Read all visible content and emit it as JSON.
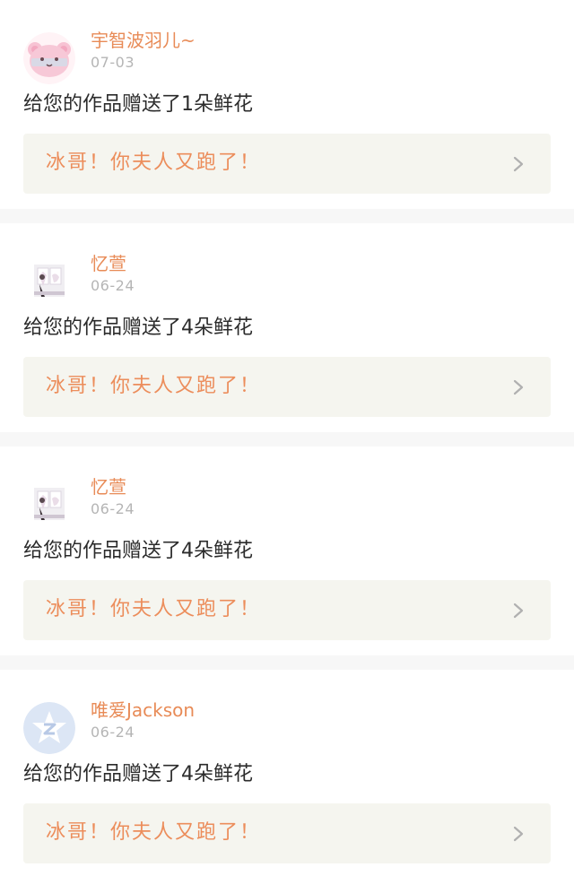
{
  "feed": {
    "items": [
      {
        "username": "宇智波羽儿~",
        "date": "07-03",
        "gift_text": "给您的作品赠送了1朵鲜花",
        "work_title": "冰哥！你夫人又跑了！",
        "avatar_icon": "pink-bear-avatar-icon"
      },
      {
        "username": "忆萱",
        "date": "06-24",
        "gift_text": "给您的作品赠送了4朵鲜花",
        "work_title": "冰哥！你夫人又跑了！",
        "avatar_icon": "photo-avatar-icon"
      },
      {
        "username": "忆萱",
        "date": "06-24",
        "gift_text": "给您的作品赠送了4朵鲜花",
        "work_title": "冰哥！你夫人又跑了！",
        "avatar_icon": "photo-avatar-icon"
      },
      {
        "username": "唯爱Jackson",
        "date": "06-24",
        "gift_text": "给您的作品赠送了4朵鲜花",
        "work_title": "冰哥！你夫人又跑了！",
        "avatar_icon": "qzone-star-avatar-icon"
      }
    ]
  },
  "colors": {
    "username": "#e88b57",
    "work_title": "#ec8d5b",
    "date": "#b5b5b5",
    "link_background": "#f5f5ef",
    "divider": "#f7f7f7"
  }
}
